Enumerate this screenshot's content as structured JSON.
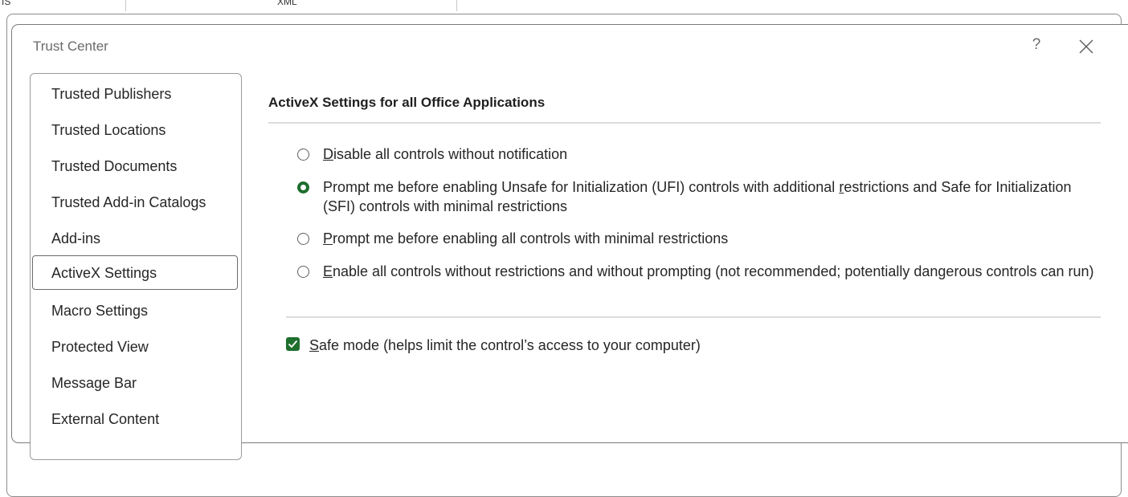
{
  "background": {
    "cell_left": "IS",
    "cell_center": "XML"
  },
  "dialog": {
    "title": "Trust Center",
    "help_label": "?"
  },
  "nav": {
    "items": [
      {
        "label": "Trusted Publishers",
        "selected": false
      },
      {
        "label": "Trusted Locations",
        "selected": false
      },
      {
        "label": "Trusted Documents",
        "selected": false
      },
      {
        "label": "Trusted Add-in Catalogs",
        "selected": false
      },
      {
        "label": "Add-ins",
        "selected": false
      },
      {
        "label": "ActiveX Settings",
        "selected": true
      },
      {
        "label": "Macro Settings",
        "selected": false
      },
      {
        "label": "Protected View",
        "selected": false
      },
      {
        "label": "Message Bar",
        "selected": false
      },
      {
        "label": "External Content",
        "selected": false
      }
    ]
  },
  "activex": {
    "section_title": "ActiveX Settings for all Office Applications",
    "options": [
      {
        "accel": "D",
        "rest": "isable all controls without notification",
        "checked": false
      },
      {
        "pre": "Prompt me before enabling Unsafe for Initialization (UFI) controls with additional ",
        "accel": "r",
        "rest": "estrictions and Safe for Initialization (SFI) controls with minimal restrictions",
        "checked": true
      },
      {
        "accel": "P",
        "rest": "rompt me before enabling all controls with minimal restrictions",
        "checked": false
      },
      {
        "accel": "E",
        "rest": "nable all controls without restrictions and without prompting (not recommended; potentially dangerous controls can run)",
        "checked": false
      }
    ],
    "safe_mode": {
      "accel": "S",
      "rest": "afe mode (helps limit the control’s access to your computer)",
      "checked": true
    }
  },
  "colors": {
    "accent_green": "#1e6e2e"
  }
}
